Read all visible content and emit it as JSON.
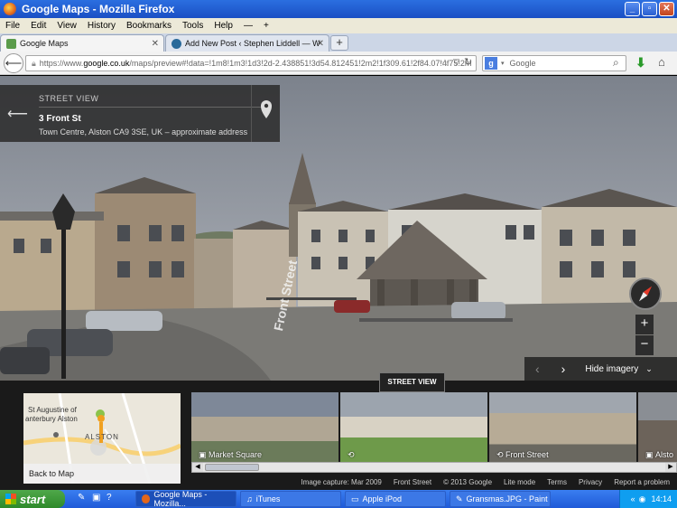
{
  "window": {
    "title": "Google Maps - Mozilla Firefox"
  },
  "menu": [
    "File",
    "Edit",
    "View",
    "History",
    "Bookmarks",
    "Tools",
    "Help"
  ],
  "tabs": [
    {
      "label": "Google Maps",
      "active": true
    },
    {
      "label": "Add New Post ‹ Stephen Liddell — WordP...",
      "active": false
    }
  ],
  "nav": {
    "url_prefix": "https://www.",
    "url_domain": "google.co.uk",
    "url_rest": "/maps/preview#!data=!1m8!1m3!1d3!2d-2.438851!3d54.812451!2m2!1f309.61!2f84.07!4f75!2m",
    "search_placeholder": "Google"
  },
  "card": {
    "label": "STREET VIEW",
    "address": "3 Front St",
    "sub": "Town Centre, Alston CA9 3SE, UK – approximate address"
  },
  "controls": {
    "hide_imagery": "Hide imagery",
    "street_view_tab": "STREET VIEW"
  },
  "minimap": {
    "poi": "St Augustine of",
    "poi2": "anterbury Alston",
    "town": "ALSTON",
    "back": "Back to Map"
  },
  "thumbs": [
    "",
    "Market Square",
    "",
    "Front Street",
    "Alsto"
  ],
  "footer": [
    "Image capture: Mar 2009",
    "Front Street",
    "© 2013 Google",
    "Lite mode",
    "Terms",
    "Privacy",
    "Report a problem"
  ],
  "taskbar": {
    "start": "start",
    "items": [
      "Google Maps - Mozilla...",
      "iTunes",
      "Apple iPod",
      "Gransmas.JPG - Paint"
    ],
    "clock": "14:14"
  },
  "street_sign": "Front Street"
}
